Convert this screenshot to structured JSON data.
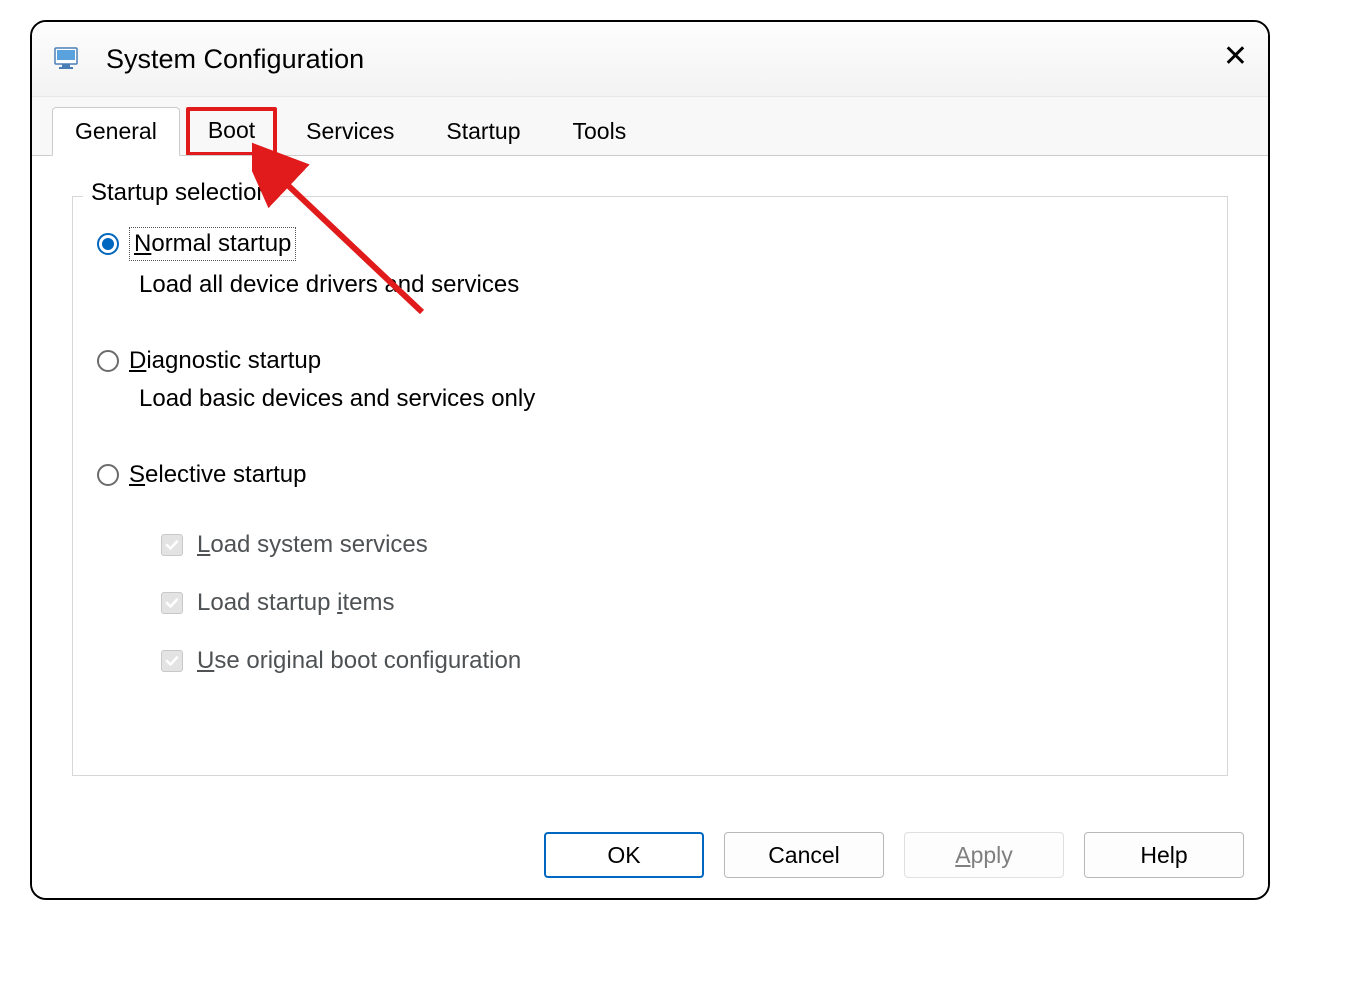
{
  "window": {
    "title": "System Configuration"
  },
  "tabs": {
    "items": [
      {
        "label": "General",
        "active": true
      },
      {
        "label": "Boot",
        "highlighted": true
      },
      {
        "label": "Services"
      },
      {
        "label": "Startup"
      },
      {
        "label": "Tools"
      }
    ]
  },
  "fieldset": {
    "legend": "Startup selection"
  },
  "radios": {
    "normal": {
      "label_pre": "N",
      "label_rest": "ormal startup",
      "desc": "Load all device drivers and services",
      "selected": true
    },
    "diagnostic": {
      "label_pre": "D",
      "label_rest": "iagnostic startup",
      "desc": "Load basic devices and services only"
    },
    "selective": {
      "label_pre": "S",
      "label_rest": "elective startup"
    }
  },
  "checkboxes": {
    "load_services": {
      "accel": "L",
      "rest": "oad system services"
    },
    "load_startup": {
      "pre": "Load startup ",
      "accel": "i",
      "rest": "tems"
    },
    "use_original": {
      "accel": "U",
      "rest": "se original boot configuration"
    }
  },
  "buttons": {
    "ok": "OK",
    "cancel": "Cancel",
    "apply_pre": "A",
    "apply_rest": "pply",
    "help": "Help"
  }
}
